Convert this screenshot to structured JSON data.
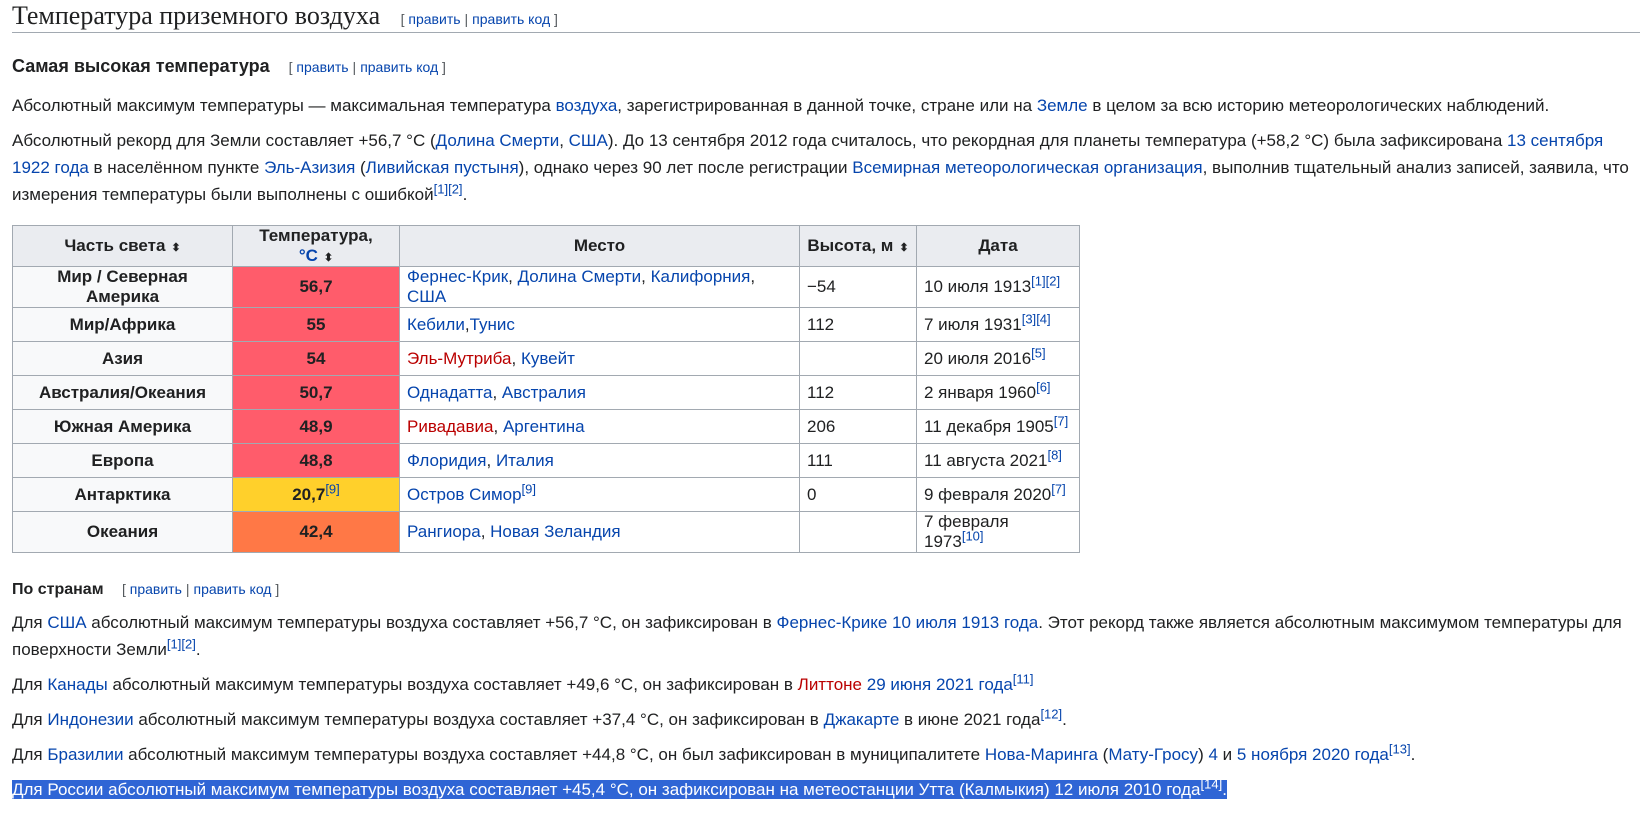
{
  "section": {
    "title": "Температура приземного воздуха",
    "edit": "править",
    "edit_code": "править код"
  },
  "sub1": {
    "title": "Самая высокая температура",
    "edit": "править",
    "edit_code": "править код"
  },
  "para1": {
    "t1": "Абсолютный максимум температуры — максимальная температура ",
    "l1": "воздуха",
    "t2": ", зарегистрированная в данной точке, стране или на ",
    "l2": "Земле",
    "t3": " в целом за всю историю метеорологических наблюдений."
  },
  "para2": {
    "t1": "Абсолютный рекорд для Земли составляет +56,7 °С (",
    "l1": "Долина Смерти",
    "t2": ", ",
    "l2": "США",
    "t3": "). До 13 сентября 2012 года считалось, что рекордная для планеты температура (+58,2 °С) была зафиксирована ",
    "l3": "13 сентября",
    "t4": " ",
    "l4": "1922 года",
    "t5": " в населённом пункте ",
    "l5": "Эль-Азизия",
    "t6": " (",
    "l6": "Ливийская пустыня",
    "t7": "), однако через 90 лет после регистрации ",
    "l7": "Всемирная метеорологическая организация",
    "t8": ", выполнив тщательный анализ записей, заявила, что измерения температуры были выполнены с ошибкой",
    "r1": "[1]",
    "r2": "[2]",
    "t9": "."
  },
  "table": {
    "headers": {
      "region": "Часть света",
      "temp": "Температура, ",
      "temp_unit": "°C",
      "place": "Место",
      "height": "Высота, м",
      "date": "Дата"
    },
    "sort_icon": "⬍",
    "rows": [
      {
        "region": "Мир / Северная Америка",
        "temp": "56,7",
        "temp_ref": "",
        "color": "#ff5c6b",
        "place": [
          {
            "text": "Фернес-Крик",
            "type": "link"
          },
          {
            "text": ", ",
            "type": "text"
          },
          {
            "text": "Долина Смерти",
            "type": "link"
          },
          {
            "text": ", ",
            "type": "text"
          },
          {
            "text": "Калифорния",
            "type": "link"
          },
          {
            "text": ", ",
            "type": "text"
          },
          {
            "text": "США",
            "type": "link"
          }
        ],
        "place_ref": "",
        "height": "−54",
        "date": "10 июля 1913",
        "refs": [
          "[1]",
          "[2]"
        ]
      },
      {
        "region": "Мир/Африка",
        "temp": "55",
        "temp_ref": "",
        "color": "#ff5c6b",
        "place": [
          {
            "text": "Кебили",
            "type": "link"
          },
          {
            "text": ",",
            "type": "text"
          },
          {
            "text": "Тунис",
            "type": "link"
          }
        ],
        "place_ref": "",
        "height": "112",
        "date": "7 июля 1931",
        "refs": [
          "[3]",
          "[4]"
        ]
      },
      {
        "region": "Азия",
        "temp": "54",
        "temp_ref": "",
        "color": "#ff5c6b",
        "place": [
          {
            "text": "Эль-Мутриба",
            "type": "red"
          },
          {
            "text": ", ",
            "type": "text"
          },
          {
            "text": "Кувейт",
            "type": "link"
          }
        ],
        "place_ref": "",
        "height": "",
        "date": "20 июля 2016",
        "refs": [
          "[5]"
        ]
      },
      {
        "region": "Австралия/Океания",
        "temp": "50,7",
        "temp_ref": "",
        "color": "#ff5c6b",
        "place": [
          {
            "text": "Однадатта",
            "type": "link"
          },
          {
            "text": ", ",
            "type": "text"
          },
          {
            "text": "Австралия",
            "type": "link"
          }
        ],
        "place_ref": "",
        "height": "112",
        "date": "2 января 1960",
        "refs": [
          "[6]"
        ]
      },
      {
        "region": "Южная Америка",
        "temp": "48,9",
        "temp_ref": "",
        "color": "#ff5c6b",
        "place": [
          {
            "text": "Ривадавиа",
            "type": "red"
          },
          {
            "text": ", ",
            "type": "text"
          },
          {
            "text": "Аргентина",
            "type": "link"
          }
        ],
        "place_ref": "",
        "height": "206",
        "date": "11 декабря 1905",
        "refs": [
          "[7]"
        ]
      },
      {
        "region": "Европа",
        "temp": "48,8",
        "temp_ref": "",
        "color": "#ff5c6b",
        "place": [
          {
            "text": "Флоридия",
            "type": "link"
          },
          {
            "text": ", ",
            "type": "text"
          },
          {
            "text": "Италия",
            "type": "link"
          }
        ],
        "place_ref": "",
        "height": "111",
        "date": "11 августа 2021",
        "refs": [
          "[8]"
        ]
      },
      {
        "region": "Антарктика",
        "temp": "20,7",
        "temp_ref": "[9]",
        "color": "#ffd02b",
        "place": [
          {
            "text": "Остров Симор",
            "type": "link"
          }
        ],
        "place_ref": "[9]",
        "height": "0",
        "date": "9 февраля 2020",
        "refs": [
          "[7]"
        ]
      },
      {
        "region": "Океания",
        "temp": "42,4",
        "temp_ref": "",
        "color": "#ff7846",
        "place": [
          {
            "text": "Рангиора",
            "type": "link"
          },
          {
            "text": ", ",
            "type": "text"
          },
          {
            "text": "Новая Зеландия",
            "type": "link"
          }
        ],
        "place_ref": "",
        "height": "",
        "date": "7 февраля 1973",
        "refs": [
          "[10]"
        ]
      }
    ]
  },
  "sub2": {
    "title": "По странам",
    "edit": "править",
    "edit_code": "править код"
  },
  "usa": {
    "t1": "Для ",
    "l1": "США",
    "t2": " абсолютный максимум температуры воздуха составляет +56,7 °C, он зафиксирован в ",
    "l2": "Фернес-Крике",
    "t3": " ",
    "l3": "10 июля",
    "t4": " ",
    "l4": "1913 года",
    "t5": ". Этот рекорд также является абсолютным максимумом температуры для поверхности Земли",
    "r1": "[1]",
    "r2": "[2]",
    "t6": "."
  },
  "canada": {
    "t1": "Для ",
    "l1": "Канады",
    "t2": " абсолютный максимум температуры воздуха составляет +49,6 °C, он зафиксирован в ",
    "l2": "Литтоне",
    "t3": " ",
    "l3": "29 июня",
    "t4": " ",
    "l4": "2021 года",
    "r1": "[11]"
  },
  "indonesia": {
    "t1": "Для ",
    "l1": "Индонезии",
    "t2": " абсолютный максимум температуры воздуха составляет +37,4 °C, он зафиксирован в ",
    "l2": "Джакарте",
    "t3": " в июне 2021 года",
    "r1": "[12]",
    "t4": "."
  },
  "brazil": {
    "t1": "Для ",
    "l1": "Бразилии",
    "t2": " абсолютный максимум температуры воздуха составляет +44,8 °C, он был зафиксирован в муниципалитете ",
    "l2": "Нова-Маринга",
    "t3": " (",
    "l3": "Мату-Гросу",
    "t4": ") ",
    "l4": "4",
    "t5": " и ",
    "l5": "5 ноября",
    "t6": " ",
    "l6": "2020 года",
    "r1": "[13]",
    "t7": "."
  },
  "russia": {
    "text": "Для России абсолютный максимум температуры воздуха составляет +45,4 °C, он зафиксирован на метеостанции Утта (Калмыкия) 12 июля 2010 года",
    "r1": "[14]",
    "t2": "."
  }
}
